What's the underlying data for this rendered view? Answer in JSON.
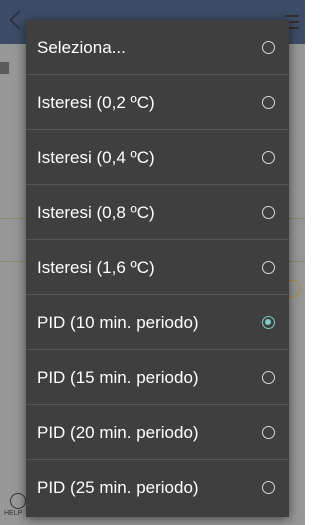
{
  "background": {
    "help_label": "HELP"
  },
  "dialog": {
    "options": [
      {
        "label": "Seleziona...",
        "selected": false
      },
      {
        "label": "Isteresi (0,2 ºC)",
        "selected": false
      },
      {
        "label": "Isteresi (0,4 ºC)",
        "selected": false
      },
      {
        "label": "Isteresi (0,8 ºC)",
        "selected": false
      },
      {
        "label": "Isteresi (1,6 ºC)",
        "selected": false
      },
      {
        "label": "PID (10 min. periodo)",
        "selected": true
      },
      {
        "label": "PID (15 min. periodo)",
        "selected": false
      },
      {
        "label": "PID (20 min. periodo)",
        "selected": false
      },
      {
        "label": "PID (25 min. periodo)",
        "selected": false
      }
    ]
  },
  "colors": {
    "dialog_bg": "#3f3f3f",
    "divider": "#555555",
    "radio_checked": "#80cbc4",
    "radio_unchecked": "#d8d8d8",
    "text": "#ffffff"
  }
}
